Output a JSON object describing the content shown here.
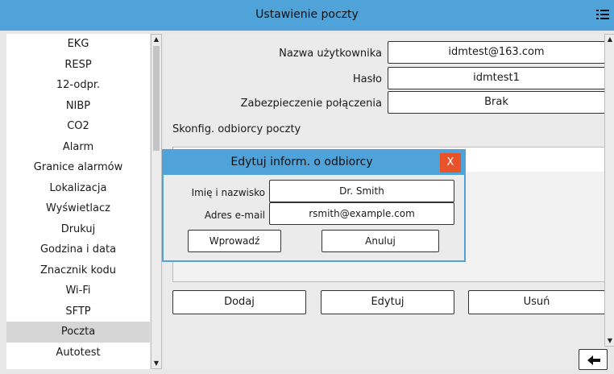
{
  "header": {
    "title": "Ustawienie poczty"
  },
  "sidebar": {
    "items": [
      {
        "label": "EKG"
      },
      {
        "label": "RESP"
      },
      {
        "label": "12-odpr."
      },
      {
        "label": "NIBP"
      },
      {
        "label": "CO2"
      },
      {
        "label": "Alarm"
      },
      {
        "label": "Granice alarmów"
      },
      {
        "label": "Lokalizacja"
      },
      {
        "label": "Wyświetlacz"
      },
      {
        "label": "Drukuj"
      },
      {
        "label": "Godzina i data"
      },
      {
        "label": "Znacznik kodu"
      },
      {
        "label": "Wi-Fi"
      },
      {
        "label": "SFTP"
      },
      {
        "label": "Poczta",
        "active": true
      },
      {
        "label": "Autotest"
      }
    ]
  },
  "form": {
    "username_label": "Nazwa użytkownika",
    "username_value": "idmtest@163.com",
    "password_label": "Hasło",
    "password_value": "idmtest1",
    "security_label": "Zabezpieczenie połączenia",
    "security_value": "Brak",
    "recipients_label": "Skonfig. odbiorcy poczty"
  },
  "actions": {
    "add": "Dodaj",
    "edit": "Edytuj",
    "delete": "Usuń"
  },
  "dialog": {
    "title": "Edytuj inform. o odbiorcy",
    "close": "X",
    "name_label": "Imię i nazwisko",
    "name_value": "Dr. Smith",
    "email_label": "Adres e-mail",
    "email_value": "rsmith@example.com",
    "confirm": "Wprowadź",
    "cancel": "Anuluj"
  },
  "colors": {
    "accent": "#4fa3d8",
    "close": "#e8532a"
  }
}
